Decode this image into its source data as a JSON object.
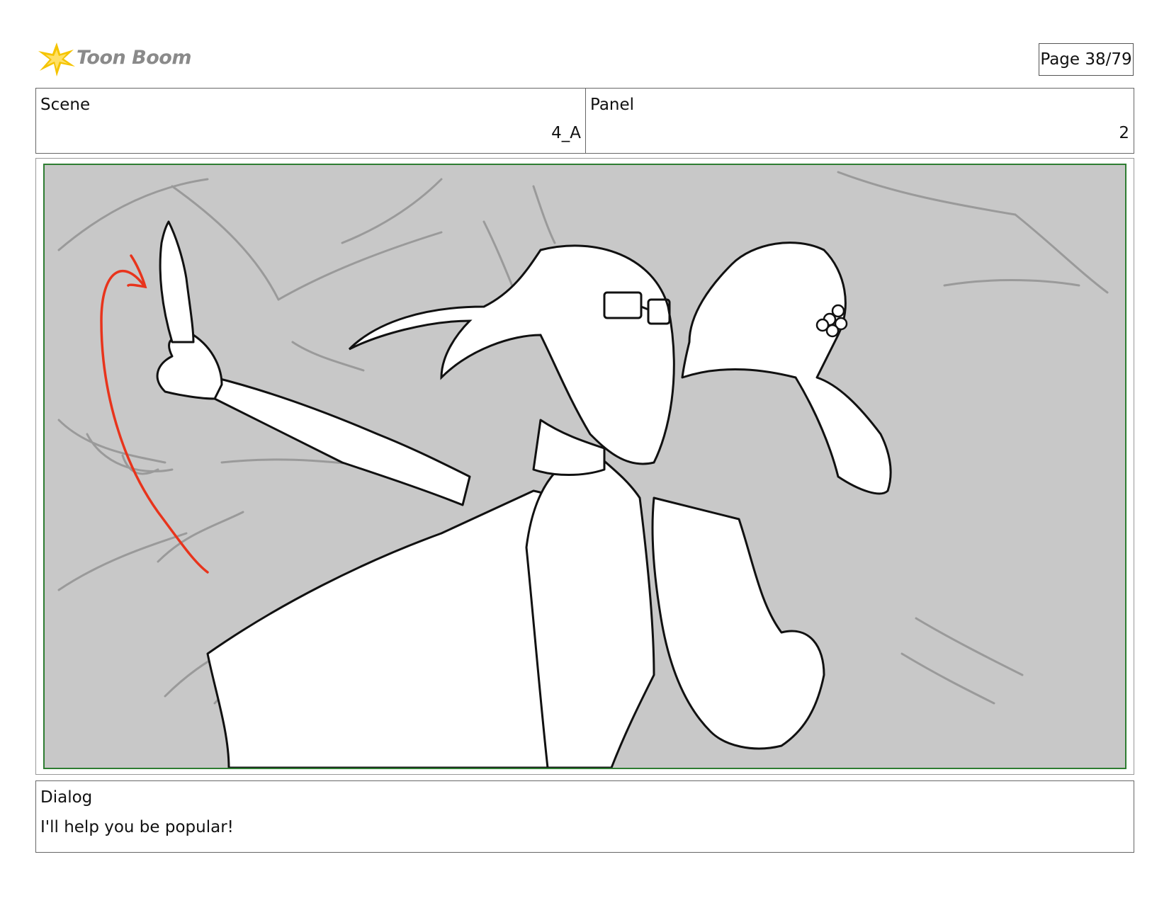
{
  "header": {
    "logo_text": "Toon Boom",
    "page_label": "Page 38/79"
  },
  "scene": {
    "label": "Scene",
    "value": "4_A"
  },
  "panel": {
    "label": "Panel",
    "value": "2"
  },
  "dialog": {
    "label": "Dialog",
    "text": "I'll help you be popular!"
  },
  "colors": {
    "frame_border": "#2e7d32",
    "background": "#c8c8c8",
    "action_arrow": "#e8341c",
    "logo_star": "#f5c400"
  }
}
